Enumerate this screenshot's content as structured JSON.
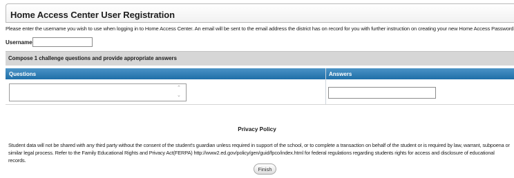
{
  "page": {
    "title": "Home Access Center User Registration",
    "intro": "Please enter the username you wish to use when logging in to Home Access Center. An email will be sent to the email address the district has on record for you with further instruction on creating your new Home Access Password."
  },
  "username": {
    "label": "Username:",
    "value": ""
  },
  "challenge": {
    "instruction": "Compose 1 challenge questions and provide appropriate answers",
    "columns": {
      "questions": "Questions",
      "answers": "Answers"
    },
    "question_value": "",
    "answer_value": ""
  },
  "privacy": {
    "heading": "Privacy Policy",
    "text": "Student data will not be shared with any third party without the consent of the student's guardian unless required in support of the school, or to complete a transaction on behalf of the student or is required by law, warrant, subpoena or similar legal process. Refer to the Family Educational Rights and Privacy Act(FERPA) http://www2.ed.gov/policy/gen/guid/fpco/index.html for federal regulations regarding students rights for access and disclosure of educational records."
  },
  "actions": {
    "finish_label": "Finish"
  },
  "icons": {
    "spin_up": "spin-up-icon",
    "spin_down": "spin-down-icon"
  },
  "colors": {
    "header_blue": "#1f6fa8",
    "challenge_bar_gray": "#d6d6d6"
  }
}
